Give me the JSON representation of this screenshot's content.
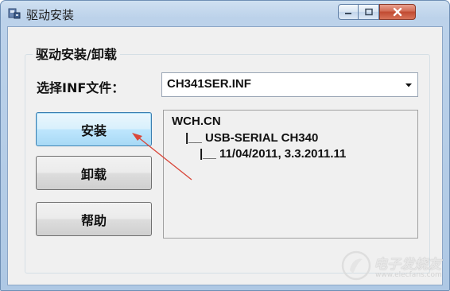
{
  "window": {
    "title": "驱动安装",
    "icon": "usb-driver-app-icon"
  },
  "group": {
    "title": "驱动安装/卸载"
  },
  "inf_select": {
    "label": "选择INF文件：",
    "value": "CH341SER.INF"
  },
  "buttons": {
    "install": "安装",
    "uninstall": "卸载",
    "help": "帮助"
  },
  "info": {
    "line1": "WCH.CN",
    "line2": "|__ USB-SERIAL CH340",
    "line3": "|__ 11/04/2011, 3.3.2011.11"
  },
  "colors": {
    "annotation_arrow": "#d9473a",
    "focused_button": "#3c7fb1",
    "close_button": "#c14a31"
  },
  "watermark": {
    "brand": "电子发烧友",
    "url": "www.elecfans.com"
  }
}
